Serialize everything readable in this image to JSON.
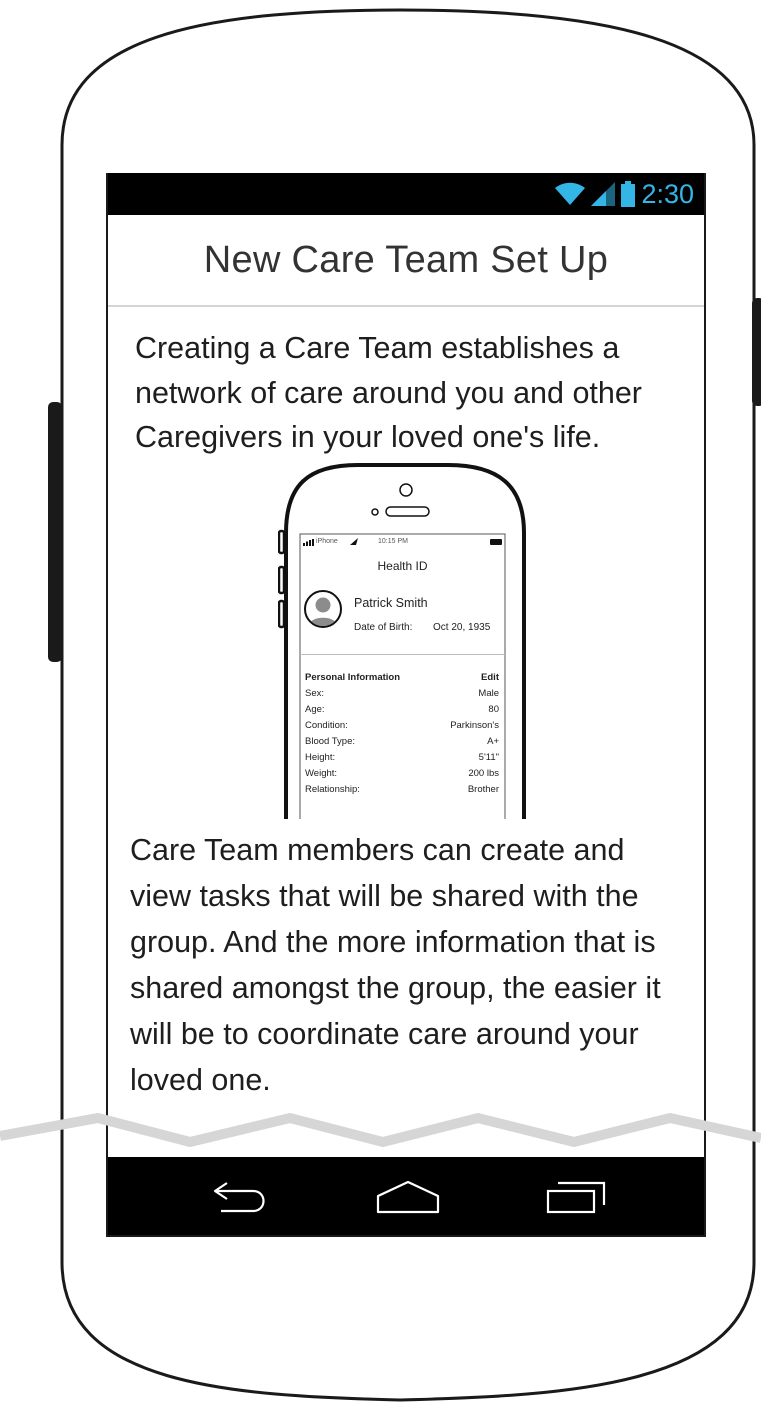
{
  "status_bar": {
    "time": "2:30",
    "accent_color": "#33b5e5",
    "icons": [
      "wifi-icon",
      "signal-icon",
      "battery-icon"
    ]
  },
  "header": {
    "title": "New Care Team Set Up"
  },
  "intro": {
    "text": "Creating a Care Team establishes a network of care around you and other Caregivers in your loved one's life."
  },
  "illustration": {
    "status": {
      "carrier": "iPhone",
      "time": "10:15 PM"
    },
    "title": "Health ID",
    "patient_name": "Patrick Smith",
    "dob_label": "Date of Birth:",
    "dob_value": "Oct 20, 1935",
    "section_title": "Personal Information",
    "edit_label": "Edit",
    "rows": [
      {
        "label": "Sex:",
        "value": "Male"
      },
      {
        "label": "Age:",
        "value": "80"
      },
      {
        "label": "Condition:",
        "value": "Parkinson's"
      },
      {
        "label": "Blood Type:",
        "value": "A+"
      },
      {
        "label": "Height:",
        "value": "5'11\""
      },
      {
        "label": "Weight:",
        "value": "200 lbs"
      },
      {
        "label": "Relationship:",
        "value": "Brother"
      }
    ]
  },
  "members": {
    "text": "Care Team members can create and view tasks that will be shared with the group. And the more information that is shared amongst the group, the easier it will be to coordinate care around your loved one."
  },
  "nav_bar": {
    "icons": [
      "back-icon",
      "home-icon",
      "recent-apps-icon"
    ]
  }
}
